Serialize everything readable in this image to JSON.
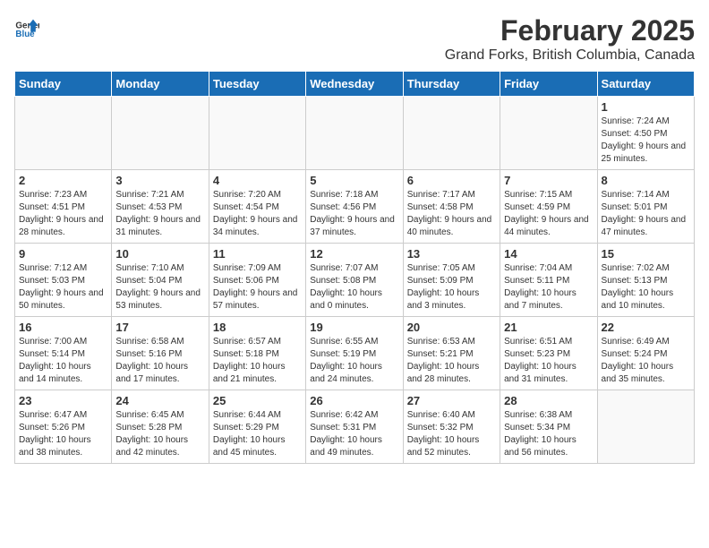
{
  "header": {
    "logo_general": "General",
    "logo_blue": "Blue",
    "title": "February 2025",
    "subtitle": "Grand Forks, British Columbia, Canada"
  },
  "weekdays": [
    "Sunday",
    "Monday",
    "Tuesday",
    "Wednesday",
    "Thursday",
    "Friday",
    "Saturday"
  ],
  "weeks": [
    [
      {
        "day": "",
        "info": ""
      },
      {
        "day": "",
        "info": ""
      },
      {
        "day": "",
        "info": ""
      },
      {
        "day": "",
        "info": ""
      },
      {
        "day": "",
        "info": ""
      },
      {
        "day": "",
        "info": ""
      },
      {
        "day": "1",
        "info": "Sunrise: 7:24 AM\nSunset: 4:50 PM\nDaylight: 9 hours and 25 minutes."
      }
    ],
    [
      {
        "day": "2",
        "info": "Sunrise: 7:23 AM\nSunset: 4:51 PM\nDaylight: 9 hours and 28 minutes."
      },
      {
        "day": "3",
        "info": "Sunrise: 7:21 AM\nSunset: 4:53 PM\nDaylight: 9 hours and 31 minutes."
      },
      {
        "day": "4",
        "info": "Sunrise: 7:20 AM\nSunset: 4:54 PM\nDaylight: 9 hours and 34 minutes."
      },
      {
        "day": "5",
        "info": "Sunrise: 7:18 AM\nSunset: 4:56 PM\nDaylight: 9 hours and 37 minutes."
      },
      {
        "day": "6",
        "info": "Sunrise: 7:17 AM\nSunset: 4:58 PM\nDaylight: 9 hours and 40 minutes."
      },
      {
        "day": "7",
        "info": "Sunrise: 7:15 AM\nSunset: 4:59 PM\nDaylight: 9 hours and 44 minutes."
      },
      {
        "day": "8",
        "info": "Sunrise: 7:14 AM\nSunset: 5:01 PM\nDaylight: 9 hours and 47 minutes."
      }
    ],
    [
      {
        "day": "9",
        "info": "Sunrise: 7:12 AM\nSunset: 5:03 PM\nDaylight: 9 hours and 50 minutes."
      },
      {
        "day": "10",
        "info": "Sunrise: 7:10 AM\nSunset: 5:04 PM\nDaylight: 9 hours and 53 minutes."
      },
      {
        "day": "11",
        "info": "Sunrise: 7:09 AM\nSunset: 5:06 PM\nDaylight: 9 hours and 57 minutes."
      },
      {
        "day": "12",
        "info": "Sunrise: 7:07 AM\nSunset: 5:08 PM\nDaylight: 10 hours and 0 minutes."
      },
      {
        "day": "13",
        "info": "Sunrise: 7:05 AM\nSunset: 5:09 PM\nDaylight: 10 hours and 3 minutes."
      },
      {
        "day": "14",
        "info": "Sunrise: 7:04 AM\nSunset: 5:11 PM\nDaylight: 10 hours and 7 minutes."
      },
      {
        "day": "15",
        "info": "Sunrise: 7:02 AM\nSunset: 5:13 PM\nDaylight: 10 hours and 10 minutes."
      }
    ],
    [
      {
        "day": "16",
        "info": "Sunrise: 7:00 AM\nSunset: 5:14 PM\nDaylight: 10 hours and 14 minutes."
      },
      {
        "day": "17",
        "info": "Sunrise: 6:58 AM\nSunset: 5:16 PM\nDaylight: 10 hours and 17 minutes."
      },
      {
        "day": "18",
        "info": "Sunrise: 6:57 AM\nSunset: 5:18 PM\nDaylight: 10 hours and 21 minutes."
      },
      {
        "day": "19",
        "info": "Sunrise: 6:55 AM\nSunset: 5:19 PM\nDaylight: 10 hours and 24 minutes."
      },
      {
        "day": "20",
        "info": "Sunrise: 6:53 AM\nSunset: 5:21 PM\nDaylight: 10 hours and 28 minutes."
      },
      {
        "day": "21",
        "info": "Sunrise: 6:51 AM\nSunset: 5:23 PM\nDaylight: 10 hours and 31 minutes."
      },
      {
        "day": "22",
        "info": "Sunrise: 6:49 AM\nSunset: 5:24 PM\nDaylight: 10 hours and 35 minutes."
      }
    ],
    [
      {
        "day": "23",
        "info": "Sunrise: 6:47 AM\nSunset: 5:26 PM\nDaylight: 10 hours and 38 minutes."
      },
      {
        "day": "24",
        "info": "Sunrise: 6:45 AM\nSunset: 5:28 PM\nDaylight: 10 hours and 42 minutes."
      },
      {
        "day": "25",
        "info": "Sunrise: 6:44 AM\nSunset: 5:29 PM\nDaylight: 10 hours and 45 minutes."
      },
      {
        "day": "26",
        "info": "Sunrise: 6:42 AM\nSunset: 5:31 PM\nDaylight: 10 hours and 49 minutes."
      },
      {
        "day": "27",
        "info": "Sunrise: 6:40 AM\nSunset: 5:32 PM\nDaylight: 10 hours and 52 minutes."
      },
      {
        "day": "28",
        "info": "Sunrise: 6:38 AM\nSunset: 5:34 PM\nDaylight: 10 hours and 56 minutes."
      },
      {
        "day": "",
        "info": ""
      }
    ]
  ]
}
